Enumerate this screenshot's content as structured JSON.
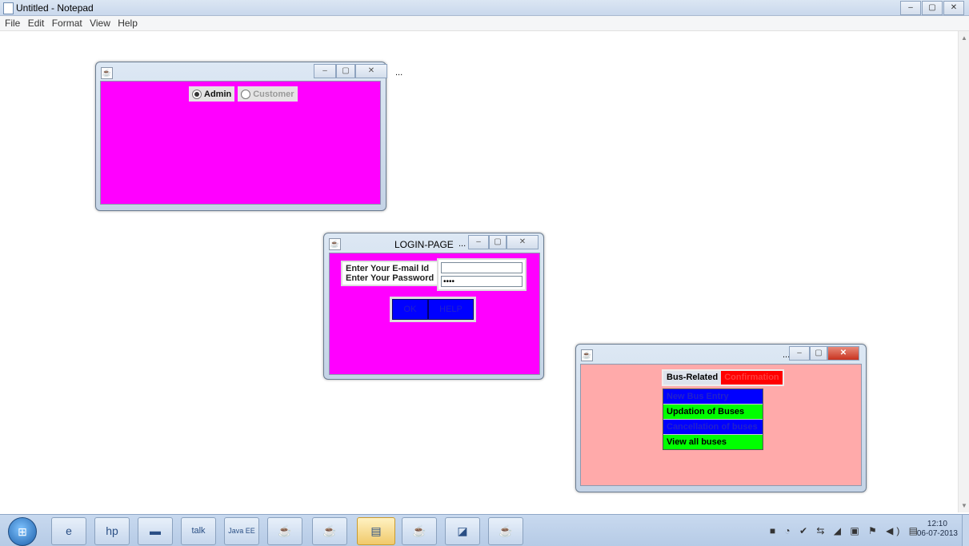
{
  "notepad": {
    "title": "Untitled - Notepad",
    "menu": [
      "File",
      "Edit",
      "Format",
      "View",
      "Help"
    ],
    "controls": [
      "–",
      "▢",
      "✕"
    ]
  },
  "radio_window": {
    "title": "",
    "dots": "...",
    "client_color": "#ff00ff",
    "options": [
      {
        "label": "Admin",
        "selected": true,
        "enabled": true
      },
      {
        "label": "Customer",
        "selected": false,
        "enabled": false
      }
    ]
  },
  "login_window": {
    "title": "LOGIN-PAGE",
    "dots": "...",
    "client_color": "#ff00ff",
    "labels": [
      "Enter Your E-mail Id",
      "Enter Your Password"
    ],
    "email_value": "",
    "password_value": "••••",
    "buttons": [
      "OK",
      "HELP"
    ]
  },
  "bus_window": {
    "title": "",
    "dots": "...",
    "client_color": "#ffaaaa",
    "menus": [
      {
        "label": "Bus-Related",
        "bg": "#dde3ec",
        "fg": "#000000"
      },
      {
        "label": "Confirmation",
        "bg": "#ff0000",
        "fg": "#ff3030"
      }
    ],
    "items": [
      {
        "label": "New Bus Entry",
        "bg": "#0000ff",
        "fg": "#2020cc"
      },
      {
        "label": "Updation of Buses",
        "bg": "#00ff00",
        "fg": "#000000"
      },
      {
        "label": "Cancellation of buses",
        "bg": "#0000ff",
        "fg": "#2020cc"
      },
      {
        "label": "View all buses",
        "bg": "#00ff00",
        "fg": "#000000"
      }
    ]
  },
  "taskbar": {
    "start_icon": "windows-orb",
    "buttons": [
      {
        "icon": "ie-icon",
        "glyph": "e"
      },
      {
        "icon": "hp-icon",
        "glyph": "hp"
      },
      {
        "icon": "app-icon",
        "glyph": "▬"
      },
      {
        "icon": "talk-icon",
        "glyph": "talk"
      },
      {
        "icon": "java-ee-ide-icon",
        "glyph": "Java EE"
      },
      {
        "icon": "java-icon",
        "glyph": "☕"
      },
      {
        "icon": "java-icon",
        "glyph": "☕"
      },
      {
        "icon": "notepad-icon",
        "glyph": "▤"
      },
      {
        "icon": "java-icon",
        "glyph": "☕"
      },
      {
        "icon": "window-icon",
        "glyph": "◪"
      },
      {
        "icon": "java-icon",
        "glyph": "☕"
      }
    ],
    "tray_icons": "■ ◔ ✔ ⇆ ◢ ▣ ⚑ ◀) ▤",
    "time": "12:10",
    "date": "06-07-2013"
  }
}
